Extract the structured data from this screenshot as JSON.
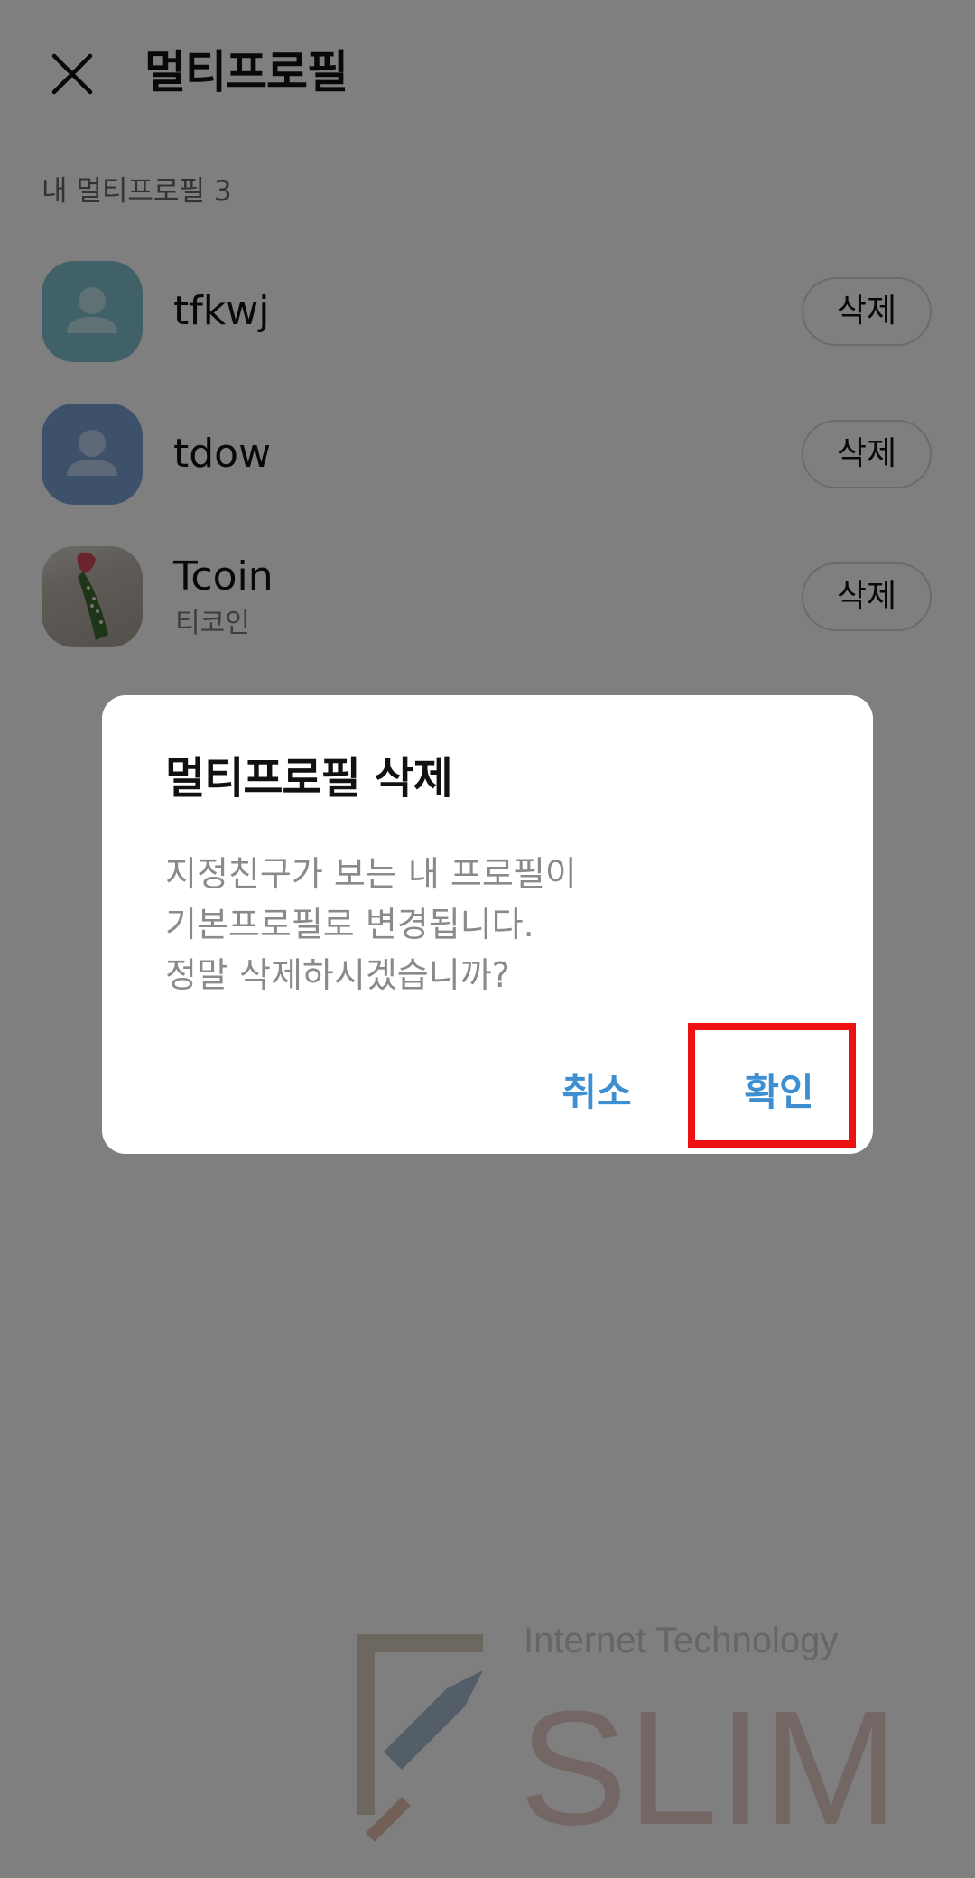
{
  "header": {
    "close_icon": "close-icon",
    "title": "멀티프로필"
  },
  "section": {
    "label": "내 멀티프로필 3"
  },
  "profiles": [
    {
      "name": "tfkwj",
      "subname": "",
      "avatar": "default-person",
      "delete_label": "삭제"
    },
    {
      "name": "tdow",
      "subname": "",
      "avatar": "default-person",
      "delete_label": "삭제"
    },
    {
      "name": "Tcoin",
      "subname": "티코인",
      "avatar": "photo",
      "delete_label": "삭제"
    }
  ],
  "dialog": {
    "title": "멀티프로필 삭제",
    "message_lines": [
      "지정친구가 보는 내 프로필이",
      "기본프로필로 변경됩니다.",
      "정말 삭제하시겠습니까?"
    ],
    "cancel_label": "취소",
    "confirm_label": "확인"
  },
  "watermark": {
    "line1": "Internet Technology",
    "line2": "SLIM"
  },
  "colors": {
    "accent": "#3d8fd1",
    "highlight": "#ee1111",
    "overlay": "rgba(0,0,0,0.5)",
    "avatar_teal": "#7ec2cf",
    "avatar_blue": "#7aa2d6"
  }
}
